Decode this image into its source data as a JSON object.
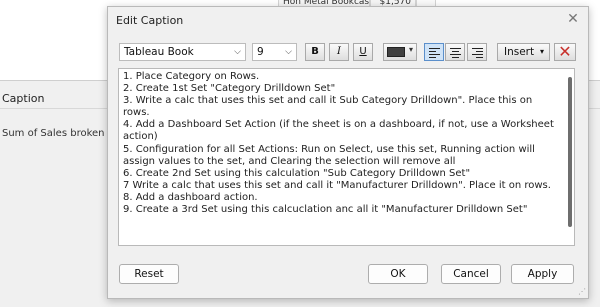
{
  "background": {
    "table_row": {
      "cell1": "Hon Metal Bookcases, Bla...",
      "cell2": "$1,570",
      "cell3": ""
    },
    "caption_label": "Caption",
    "caption_text": "Sum of Sales broken d"
  },
  "dialog": {
    "title": "Edit Caption",
    "close_icon": "close-icon"
  },
  "toolbar": {
    "font_family": "Tableau Book",
    "font_size": "9",
    "bold_label": "B",
    "italic_label": "I",
    "underline_label": "U",
    "text_color": "#404040",
    "align_options": [
      "align-left",
      "align-center",
      "align-right"
    ],
    "align_selected": "align-left",
    "insert_label": "Insert",
    "clear_icon": "clear-x-icon"
  },
  "editor": {
    "lines": [
      "1. Place Category on Rows.",
      "2. Create 1st Set \"Category Drilldown Set\"",
      "3. Write a calc that uses this set and call it Sub Category Drilldown\". Place this on rows.",
      "4. Add a Dashboard Set Action (if the sheet is on a dashboard, if not, use a Worksheet action)",
      "5. Configuration for all Set Actions:  Run on Select, use this set, Running action will assign values to the set, and Clearing the selection will remove all",
      "6. Create 2nd Set using this calculation \"Sub Category Drilldown Set\"",
      "7 Write a calc that uses this set and call it \"Manufacturer Drilldown\". Place it on rows.",
      "8. Add a dashboard action.",
      "9. Create a 3rd Set using this calcuclation anc all it \"Manufacturer Drilldown Set\""
    ]
  },
  "footer": {
    "reset_label": "Reset",
    "ok_label": "OK",
    "cancel_label": "Cancel",
    "apply_label": "Apply"
  },
  "colors": {
    "dialog_bg": "#f0f0f0",
    "accent": "#5b8fcb",
    "clear_red": "#c8302b"
  }
}
